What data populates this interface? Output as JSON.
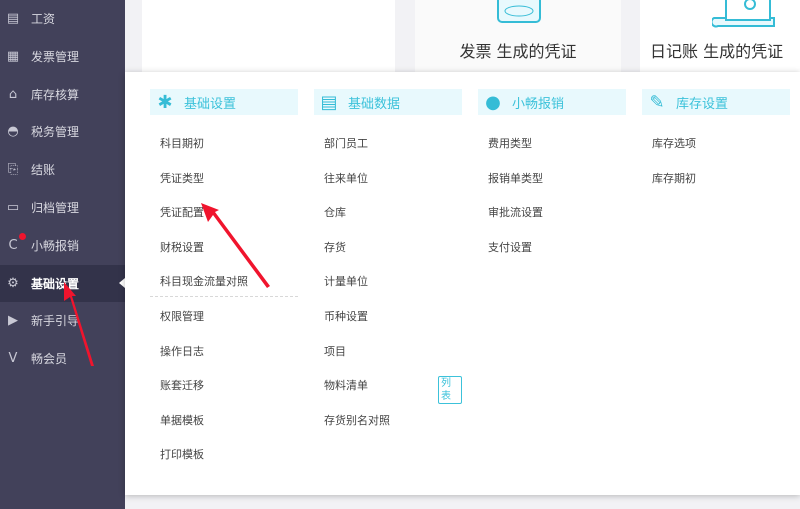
{
  "sidebar": {
    "items": [
      {
        "label": "工资",
        "icon": "salary-icon"
      },
      {
        "label": "发票管理",
        "icon": "invoice-icon"
      },
      {
        "label": "库存核算",
        "icon": "warehouse-icon"
      },
      {
        "label": "税务管理",
        "icon": "tax-icon"
      },
      {
        "label": "结账",
        "icon": "checkout-icon"
      },
      {
        "label": "归档管理",
        "icon": "archive-icon"
      },
      {
        "label": "小畅报销",
        "icon": "reimburse-icon",
        "notification": true
      },
      {
        "label": "基础设置",
        "icon": "gear-icon",
        "active": true
      },
      {
        "label": "新手引导",
        "icon": "video-guide-icon"
      },
      {
        "label": "畅会员",
        "icon": "vip-icon"
      }
    ]
  },
  "cards": [
    {
      "label": "发票 生成的凭证"
    },
    {
      "label": "日记账 生成的凭证"
    }
  ],
  "menu": {
    "columns": [
      {
        "title": "基础设置",
        "icon": "settings-card-icon",
        "items": [
          "科目期初",
          "凭证类型",
          "凭证配置",
          "财税设置",
          "科目现金流量对照"
        ],
        "items2": [
          "权限管理",
          "操作日志",
          "账套迁移",
          "单据模板",
          "打印模板"
        ]
      },
      {
        "title": "基础数据",
        "icon": "id-card-icon",
        "items": [
          "部门员工",
          "往来单位",
          "仓库",
          "存货",
          "计量单位",
          "币种设置",
          "项目",
          "物料清单",
          "存货别名对照"
        ],
        "badge": "列表"
      },
      {
        "title": "小畅报销",
        "icon": "reimburse-logo-icon",
        "items": [
          "费用类型",
          "报销单类型",
          "审批流设置",
          "支付设置"
        ]
      },
      {
        "title": "库存设置",
        "icon": "wrench-icon",
        "items": [
          "库存选项",
          "库存期初"
        ]
      }
    ]
  },
  "colors": {
    "sidebar": "#42415a",
    "accent": "#3cc2da",
    "annotation": "#f0142d"
  }
}
